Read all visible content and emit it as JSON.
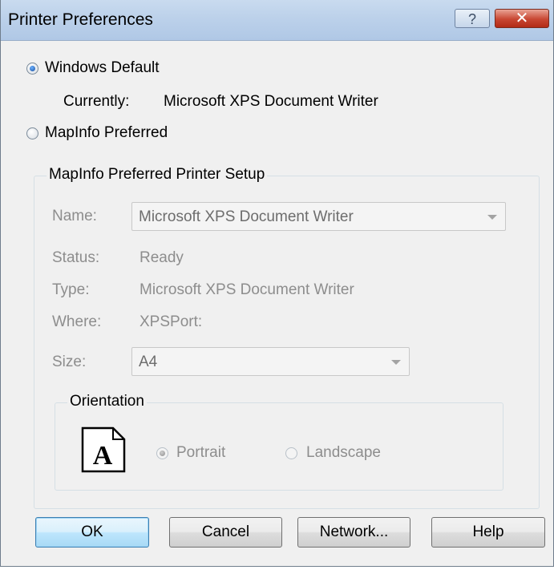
{
  "window": {
    "title": "Printer Preferences",
    "help_label": "?",
    "close_label": "✕"
  },
  "source": {
    "windows_default_label": "Windows Default",
    "currently_label": "Currently:",
    "currently_value": "Microsoft XPS Document Writer",
    "mapinfo_preferred_label": "MapInfo Preferred",
    "selected": "Windows Default"
  },
  "setup": {
    "group_label": "MapInfo Preferred Printer Setup",
    "name_label": "Name:",
    "name_value": "Microsoft XPS Document Writer",
    "status_label": "Status:",
    "status_value": "Ready",
    "type_label": "Type:",
    "type_value": "Microsoft XPS Document Writer",
    "where_label": "Where:",
    "where_value": "XPSPort:",
    "size_label": "Size:",
    "size_value": "A4"
  },
  "orientation": {
    "group_label": "Orientation",
    "icon_letter": "A",
    "portrait_label": "Portrait",
    "landscape_label": "Landscape",
    "selected": "Portrait"
  },
  "buttons": {
    "ok": "OK",
    "cancel": "Cancel",
    "network": "Network...",
    "help": "Help"
  },
  "colors": {
    "titlebar": "#bcd1ea",
    "close_button": "#c84632",
    "disabled_text": "#8d8d8d",
    "default_button_border": "#3c7fb1"
  }
}
